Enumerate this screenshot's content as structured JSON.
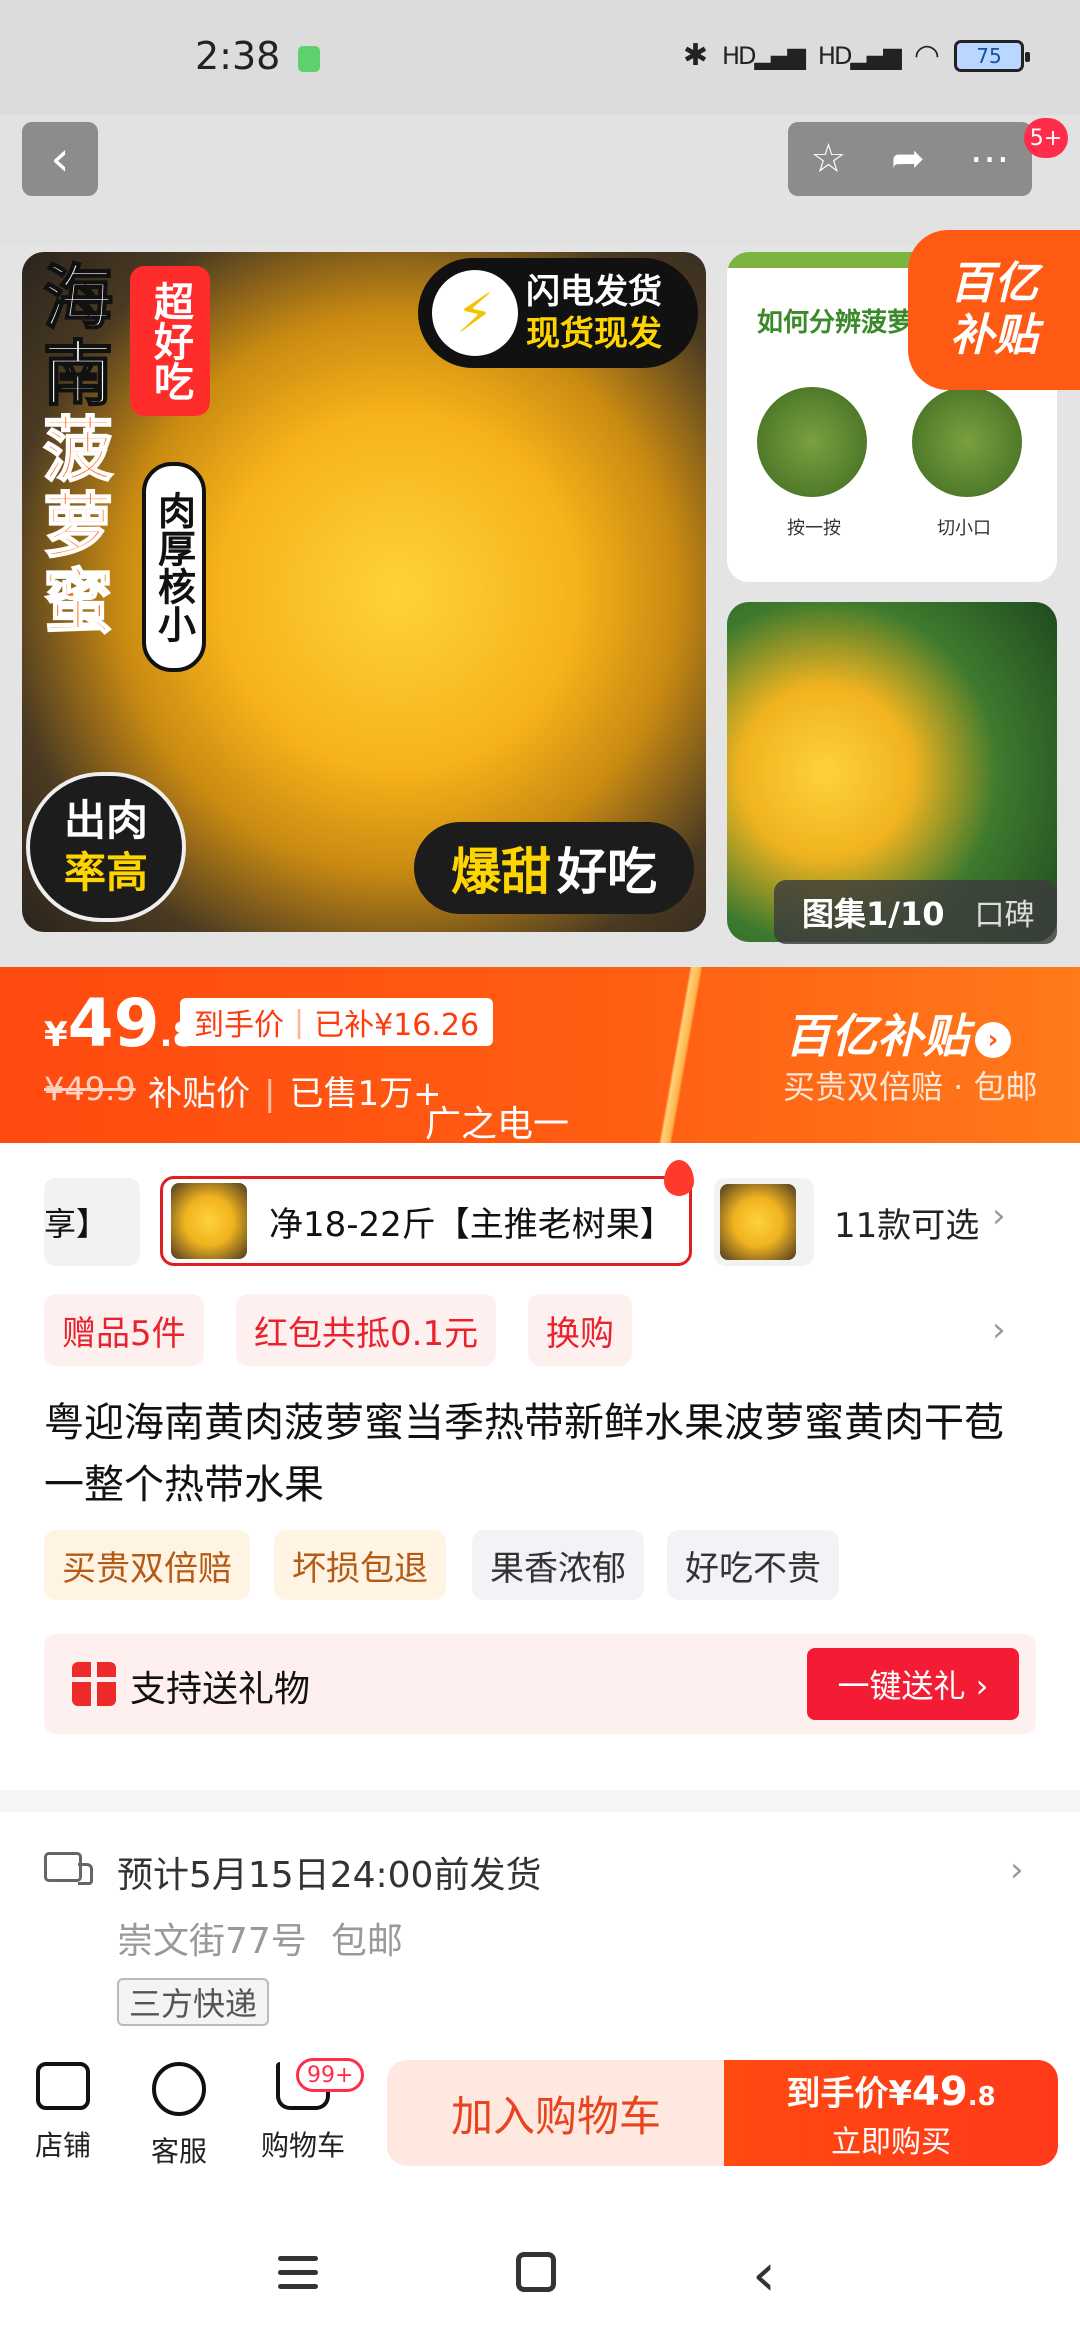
{
  "status_bar": {
    "time": "2:38",
    "network_1": "HD",
    "network_2": "HD",
    "battery": "75"
  },
  "header": {
    "back_icon": "chevron-left-icon",
    "actions": [
      "star-icon",
      "share-icon",
      "more-icon"
    ],
    "message_badge": "5+"
  },
  "gallery": {
    "main_title_chars": [
      "海",
      "南"
    ],
    "main_title_chars_orange": [
      "菠",
      "萝",
      "蜜"
    ],
    "tag_super": "超好吃",
    "tag_thick": "肉厚核小",
    "lightning_line1": "闪电发货",
    "lightning_line2": "现货现发",
    "rate_line1": "出肉",
    "rate_line2": "率高",
    "sweet_a": "爆甜",
    "sweet_b": "好吃",
    "side_question": "如何分辨菠萝",
    "side_label_1": "按一按",
    "side_label_2": "切小口",
    "count": "图集1/10",
    "reviews": "口碑",
    "subsidy_line1": "百亿",
    "subsidy_line2": "补贴"
  },
  "price": {
    "currency": "¥",
    "integer": "49",
    "decimal": ".8",
    "hand_label": "到手价",
    "subsidy_amount": "已补¥16.26",
    "original": "¥49.9",
    "subsidy_price_label": "补贴价",
    "sold": "已售1万+",
    "watermark": "广之电一",
    "brand": "百亿补贴",
    "brand_sub": "买贵双倍赔 · 包邮"
  },
  "sku": {
    "prev_partial": "享】",
    "active": "净18-22斤【主推老树果】",
    "more": "11款可选"
  },
  "promos": [
    "赠品5件",
    "红包共抵0.1元",
    "换购"
  ],
  "title": "粤迎海南黄肉菠萝蜜当季热带新鲜水果波萝蜜黄肉干苞一整个热带水果",
  "services": [
    "买贵双倍赔",
    "坏损包退",
    "果香浓郁",
    "好吃不贵"
  ],
  "gift": {
    "label": "支持送礼物",
    "button": "一键送礼 ›"
  },
  "delivery": {
    "time": "预计5月15日24:00前发货",
    "address": "崇文街77号",
    "free_shipping": "包邮",
    "courier": "三方快递"
  },
  "bottom_bar": {
    "store": "店铺",
    "service": "客服",
    "cart": "购物车",
    "cart_badge": "99+",
    "add_to_cart": "加入购物车",
    "buy_price_label": "到手价",
    "buy_currency": "¥",
    "buy_int": "49",
    "buy_dec": ".8",
    "buy_now": "立即购买"
  },
  "colors": {
    "accent": "#ff4a10",
    "promo_red": "#e8232e",
    "gift_button": "#f41c34"
  }
}
